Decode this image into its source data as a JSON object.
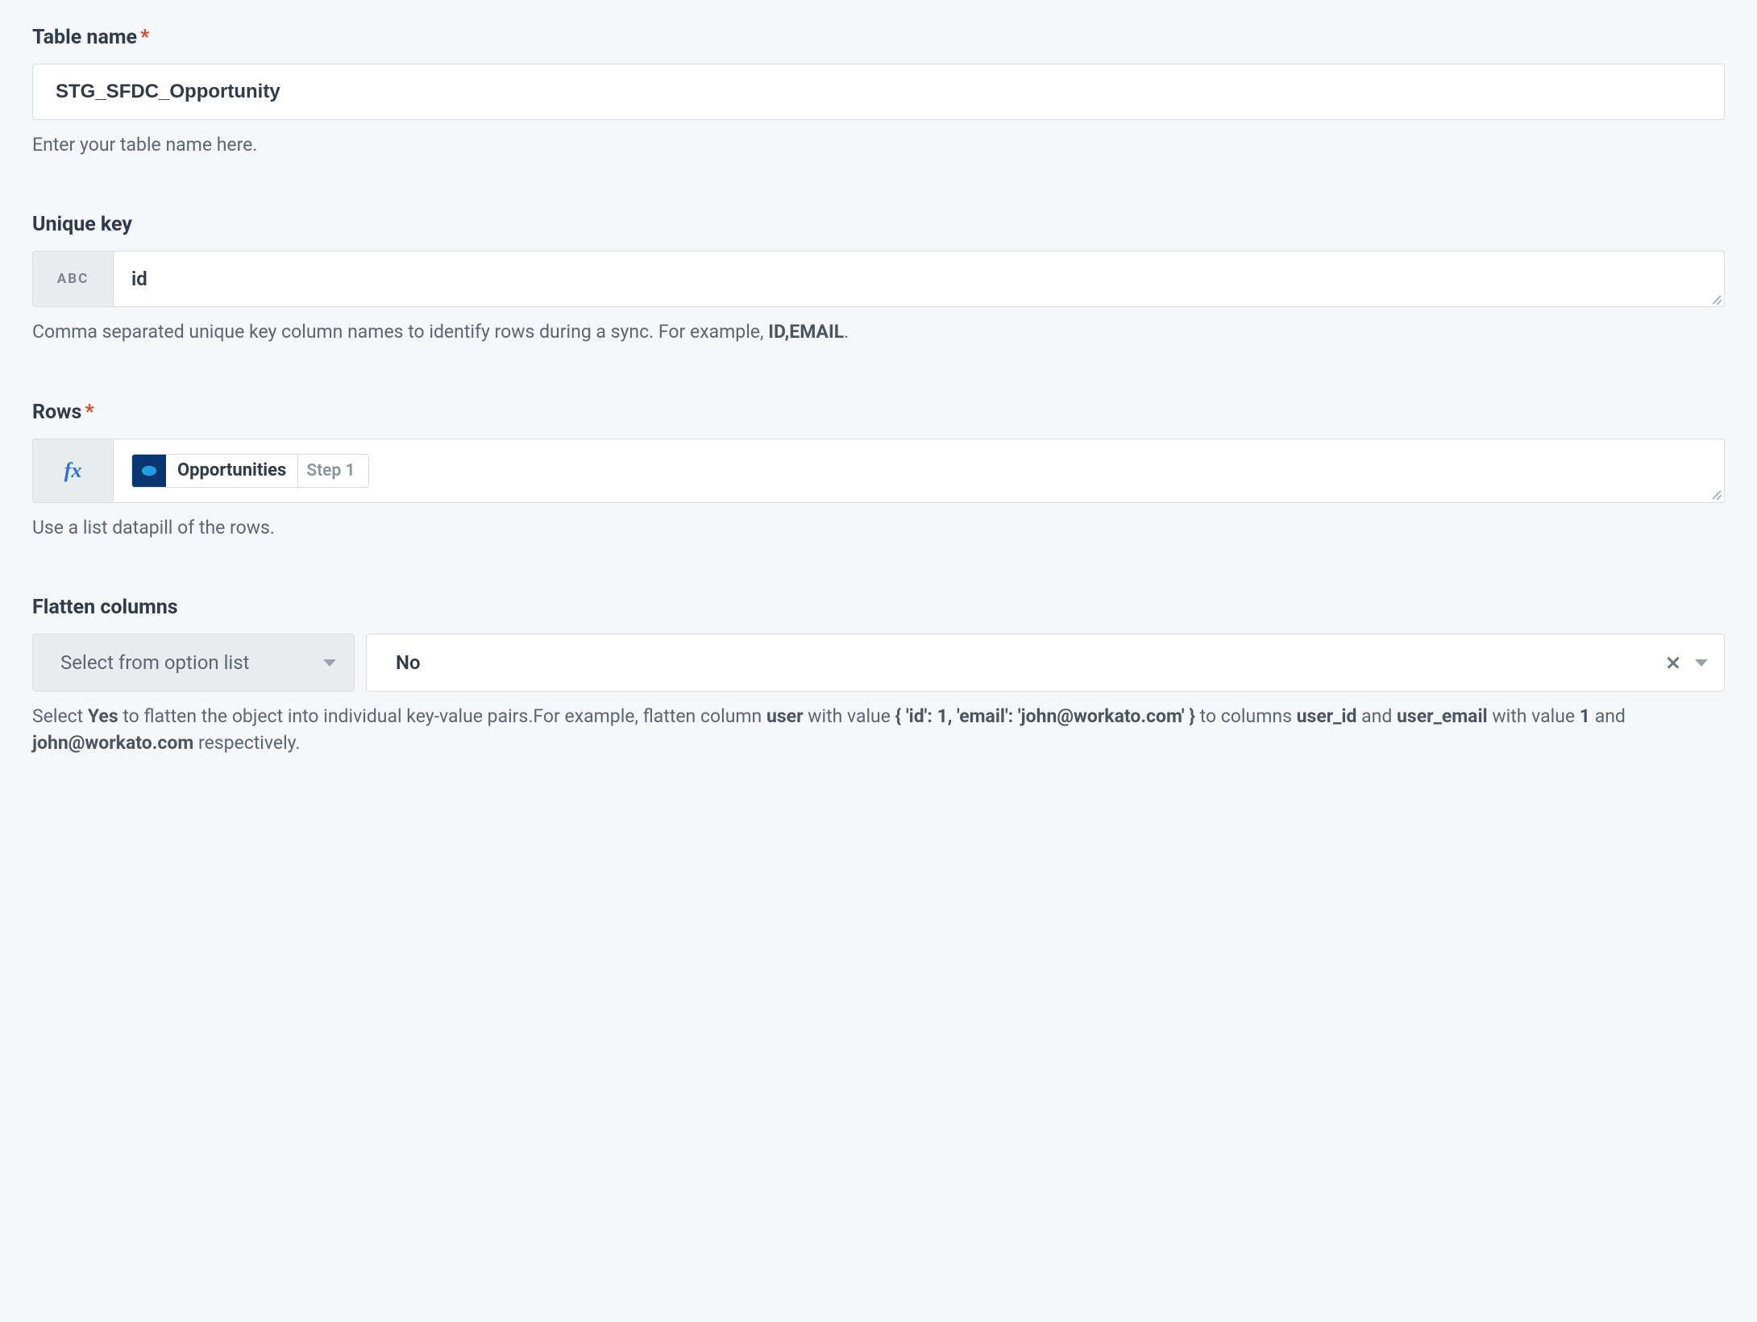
{
  "fields": {
    "table_name": {
      "label": "Table name",
      "required": true,
      "value": "STG_SFDC_Opportunity",
      "help": "Enter your table name here."
    },
    "unique_key": {
      "label": "Unique key",
      "required": false,
      "prefix_badge": "ABC",
      "value": "id",
      "help_prefix": "Comma separated unique key column names to identify rows during a sync. For example, ",
      "help_bold": "ID,EMAIL",
      "help_suffix": "."
    },
    "rows": {
      "label": "Rows",
      "required": true,
      "prefix_badge": "fx",
      "datapill": {
        "label": "Opportunities",
        "step": "Step 1"
      },
      "help": "Use a list datapill of the rows."
    },
    "flatten_columns": {
      "label": "Flatten columns",
      "required": false,
      "select_label": "Select from option list",
      "value": "No",
      "help": {
        "t1": "Select ",
        "b1": "Yes",
        "t2": " to flatten the object into individual key-value pairs.For example, flatten column ",
        "b2": "user",
        "t3": " with value ",
        "b3": "{ 'id': 1, 'email': 'john@workato.com' }",
        "t4": " to columns ",
        "b4": "user_id",
        "t5": " and ",
        "b5": "user_email",
        "t6": " with value ",
        "b6": "1",
        "t7": " and ",
        "b7": "john@workato.com",
        "t8": " respectively."
      }
    }
  }
}
